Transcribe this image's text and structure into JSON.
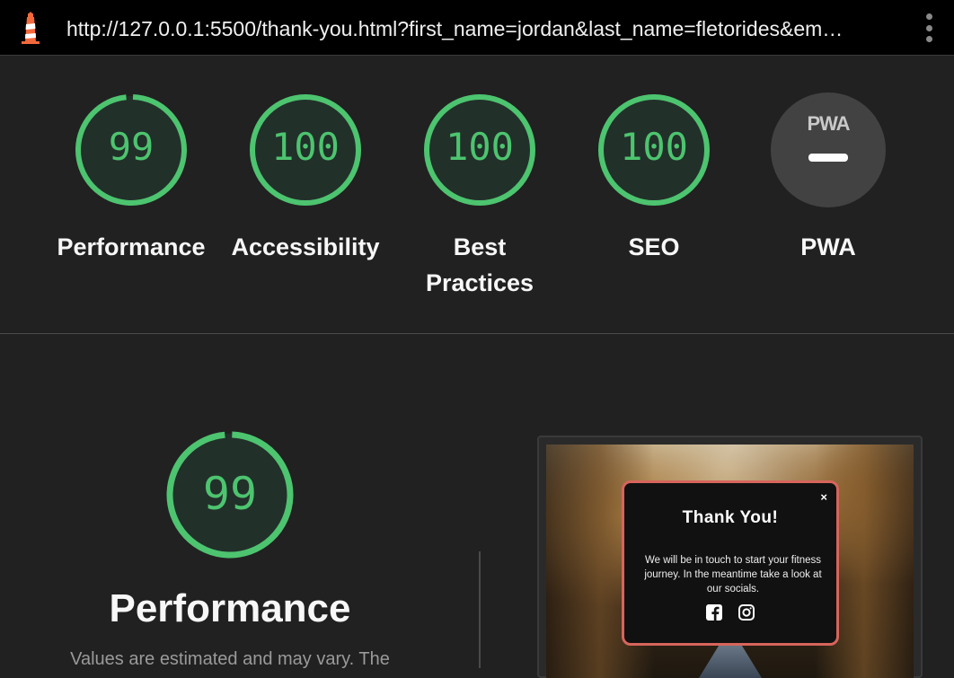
{
  "toolbar": {
    "logo_icon": "lighthouse-icon",
    "url": "http://127.0.0.1:5500/thank-you.html?first_name=jordan&last_name=fletorides&em…",
    "menu_icon": "kebab-menu-icon"
  },
  "scores": [
    {
      "value": "99",
      "label": "Performance",
      "progress": 0.99
    },
    {
      "value": "100",
      "label": "Accessibility",
      "progress": 1.0
    },
    {
      "value": "100",
      "label": "Best Practices",
      "progress": 1.0
    },
    {
      "value": "100",
      "label": "SEO",
      "progress": 1.0
    }
  ],
  "pwa": {
    "badge": "PWA",
    "label": "PWA"
  },
  "performance": {
    "score": "99",
    "progress": 0.99,
    "title": "Performance",
    "description": "Values are estimated and may vary. The"
  },
  "screenshot": {
    "modal_close": "×",
    "modal_title": "Thank You!",
    "modal_text": "We will be in touch to start your fitness journey. In the meantime take a look at our socials.",
    "social_icons": [
      "facebook-icon",
      "instagram-icon"
    ]
  },
  "colors": {
    "pass": "#4dc46f",
    "gauge_bg": "#283a2d",
    "modal_border": "#d7655b"
  }
}
